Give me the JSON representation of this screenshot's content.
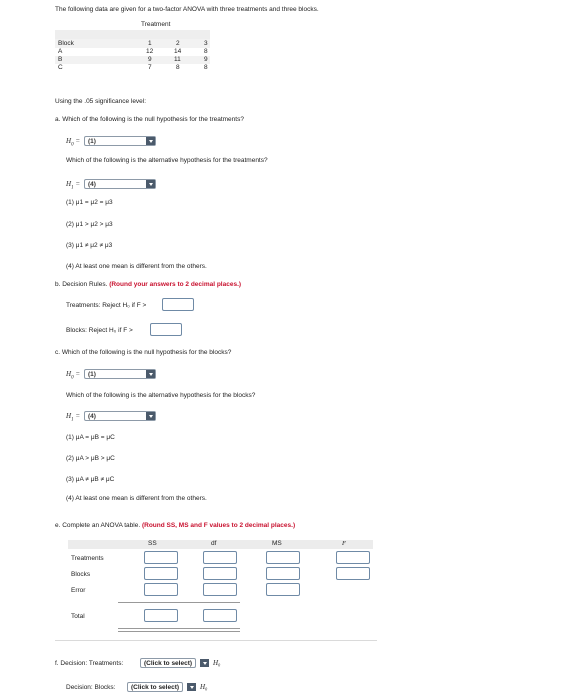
{
  "intro": "The following data are given for a two-factor ANOVA with three treatments and three blocks.",
  "table": {
    "treatment_label": "Treatment",
    "block_label": "Block",
    "columns": [
      "1",
      "2",
      "3"
    ],
    "rows": [
      {
        "block": "A",
        "values": [
          "12",
          "14",
          "8"
        ]
      },
      {
        "block": "B",
        "values": [
          "9",
          "11",
          "9"
        ]
      },
      {
        "block": "C",
        "values": [
          "7",
          "8",
          "8"
        ]
      }
    ]
  },
  "significance": "Using the .05 significance level:",
  "part_a": {
    "question": "a. Which of the following is the null hypothesis for the treatments?",
    "h0_label": "H",
    "h0_sub": "0",
    "h0_value": "(1)",
    "alt_question": "Which of the following is the alternative hypothesis for the treatments?",
    "h1_label": "H",
    "h1_sub": "1",
    "h1_value": "(4)",
    "options": [
      "(1) μ1 = μ2 = μ3",
      "(2) μ1 > μ2 > μ3",
      "(3) μ1 ≠ μ2 ≠ μ3",
      "(4) At least one mean is different from the others."
    ]
  },
  "part_b": {
    "prefix": "b. Decision Rules.",
    "instruction": "(Round your answers to 2 decimal places.)",
    "treatments_rule": "Treatments: Reject H₀ if F >",
    "blocks_rule": "Blocks: Reject H₀ if F >"
  },
  "part_c": {
    "question": "c. Which of the following is the null hypothesis for the blocks?",
    "h0_value": "(1)",
    "alt_question": "Which of the following is the alternative hypothesis for the blocks?",
    "h1_value": "(4)",
    "options": [
      "(1) μA = μB = μC",
      "(2) μA > μB > μC",
      "(3) μA ≠ μB ≠ μC",
      "(4) At least one mean is different from the others."
    ]
  },
  "part_e": {
    "prefix": "e. Complete an ANOVA table.",
    "instruction": "(Round SS, MS and F values to 2 decimal places.)",
    "headers": [
      "SS",
      "df",
      "MS",
      "F"
    ],
    "rows": [
      "Treatments",
      "Blocks",
      "Error"
    ],
    "total": "Total"
  },
  "part_f": {
    "treatments_label": "f. Decision: Treatments:",
    "blocks_label": "Decision: Blocks:",
    "select_text": "(Click to select)",
    "h0": "H₀"
  },
  "colors": {
    "accent_red": "#c8102e",
    "select_button": "#4b5a6b",
    "input_border": "#6f8aa6"
  }
}
